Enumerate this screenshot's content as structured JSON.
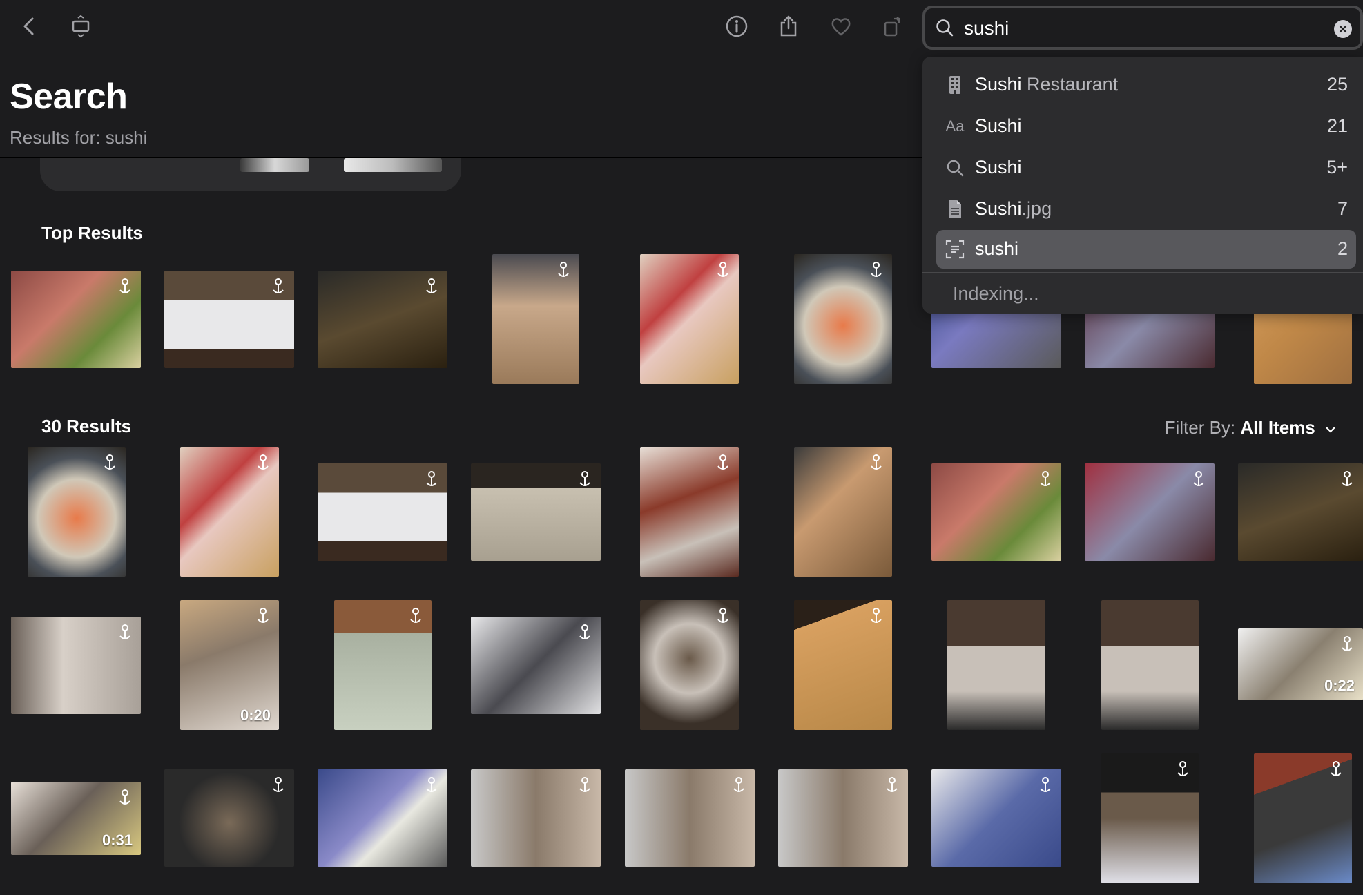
{
  "toolbar": {
    "buttons": [
      {
        "name": "back-button",
        "icon": "chevron-left-icon"
      },
      {
        "name": "slideshow-button",
        "icon": "slideshow-icon"
      },
      {
        "name": "info-button",
        "icon": "info-icon"
      },
      {
        "name": "share-button",
        "icon": "share-icon"
      },
      {
        "name": "favorite-button",
        "icon": "heart-icon"
      },
      {
        "name": "rotate-button",
        "icon": "rotate-icon"
      }
    ]
  },
  "header": {
    "title": "Search",
    "subtitle": "Results for: sushi"
  },
  "search": {
    "value": "sushi",
    "suggestions": [
      {
        "icon": "building-icon",
        "glyph": "▦",
        "strong": "Sushi",
        "dim": " Restaurant",
        "count": "25"
      },
      {
        "icon": "text-icon",
        "glyph": "Aa",
        "strong": "Sushi",
        "dim": "",
        "count": "21"
      },
      {
        "icon": "search-icon",
        "glyph": "",
        "strong": "Sushi",
        "dim": "",
        "count": "5+"
      },
      {
        "icon": "document-icon",
        "glyph": "",
        "strong": "Sushi",
        "dim": ".jpg",
        "count": "7"
      },
      {
        "icon": "text-recognition-icon",
        "glyph": "",
        "strong": "sushi",
        "dim": "",
        "count": "2",
        "selected": true
      }
    ],
    "indexing": "Indexing..."
  },
  "sections": {
    "top_title": "Top Results",
    "results_title": "30 Results",
    "filter_label": "Filter By:",
    "filter_value": "All Items"
  },
  "durations": [
    "0:20",
    "0:22",
    "0:31"
  ],
  "colors": {
    "background": "#1c1c1e",
    "dropdown": "#2c2c2e",
    "selected_row": "#58585c",
    "secondary_text": "#a1a1a6"
  }
}
